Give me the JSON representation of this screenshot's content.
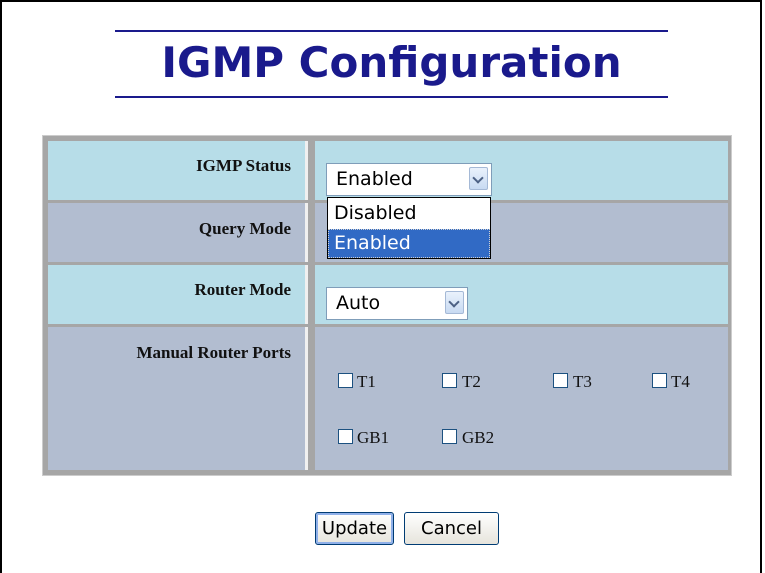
{
  "page": {
    "title": "IGMP Configuration"
  },
  "form": {
    "igmp_status": {
      "label": "IGMP Status",
      "value": "Enabled",
      "options": [
        "Disabled",
        "Enabled"
      ]
    },
    "query_mode": {
      "label": "Query Mode"
    },
    "router_mode": {
      "label": "Router Mode",
      "value": "Auto"
    },
    "manual_router_ports": {
      "label": "Manual Router Ports",
      "ports": [
        {
          "label": "T1",
          "checked": false
        },
        {
          "label": "T2",
          "checked": false
        },
        {
          "label": "T3",
          "checked": false
        },
        {
          "label": "T4",
          "checked": false
        },
        {
          "label": "GB1",
          "checked": false
        },
        {
          "label": "GB2",
          "checked": false
        }
      ]
    }
  },
  "buttons": {
    "update": "Update",
    "cancel": "Cancel"
  }
}
